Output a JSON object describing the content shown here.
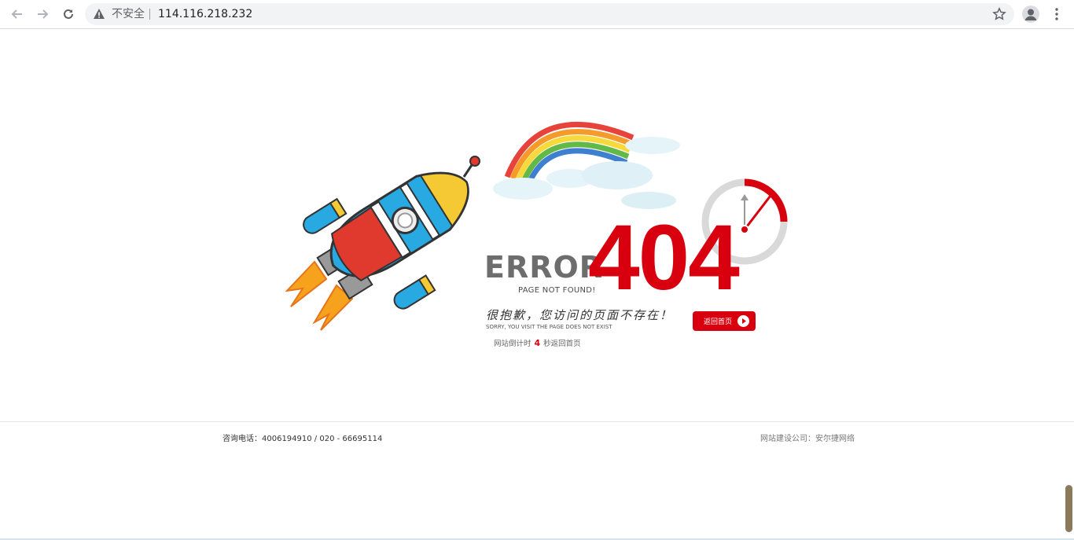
{
  "browser": {
    "security_label": "不安全",
    "url": "114.116.218.232",
    "icons": [
      "back-icon",
      "forward-icon",
      "reload-icon",
      "warning-icon",
      "star-icon",
      "account-icon",
      "menu-icon"
    ]
  },
  "error": {
    "word": "ERROR",
    "code": "404",
    "page_not_found": "PAGE NOT FOUND!",
    "sorry_cn": "很抱歉，您访问的页面不存在！",
    "sorry_en": "SORRY, YOU VISIT THE PAGE DOES NOT EXIST",
    "back_button": "返回首页",
    "countdown_prefix": "网站倒计时",
    "countdown_value": "4",
    "countdown_suffix": "秒返回首页"
  },
  "footer": {
    "contact": "咨询电话：4006194910 / 020 - 66695114",
    "builder": "网站建设公司：安尔捷网络"
  },
  "colors": {
    "accent_red": "#d8000f",
    "text_gray": "#6d6d6d"
  }
}
